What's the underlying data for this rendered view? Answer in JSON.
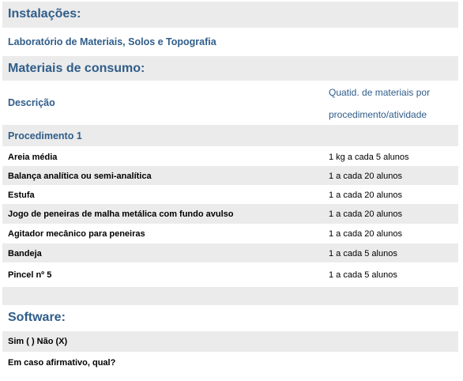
{
  "installations": {
    "heading": "Instalações:",
    "value": "Laboratório de Materiais, Solos e Topografia"
  },
  "consumables": {
    "heading": "Materiais de consumo:",
    "col_description": "Descrição",
    "col_quantity_line1": "Quatid. de materiais por",
    "col_quantity_line2": "procedimento/atividade",
    "procedure_title": "Procedimento 1",
    "items": [
      {
        "name": "Areia média",
        "qty": "1 kg a cada 5 alunos"
      },
      {
        "name": "Balança analítica ou semi-analítica",
        "qty": "1 a cada 20 alunos"
      },
      {
        "name": "Estufa",
        "qty": "1 a cada 20 alunos"
      },
      {
        "name": "Jogo de peneiras de malha metálica com fundo avulso",
        "qty": "1 a cada 20 alunos"
      },
      {
        "name": "Agitador mecânico para peneiras",
        "qty": "1 a cada 20 alunos"
      },
      {
        "name": "Bandeja",
        "qty": "1 a cada 5 alunos"
      },
      {
        "name": "Pincel nº 5",
        "qty": "1 a cada 5 alunos"
      }
    ]
  },
  "software": {
    "heading": "Software:",
    "yes_no": "Sim (  ) Não (X)",
    "if_yes": "Em caso afirmativo, qual?"
  }
}
